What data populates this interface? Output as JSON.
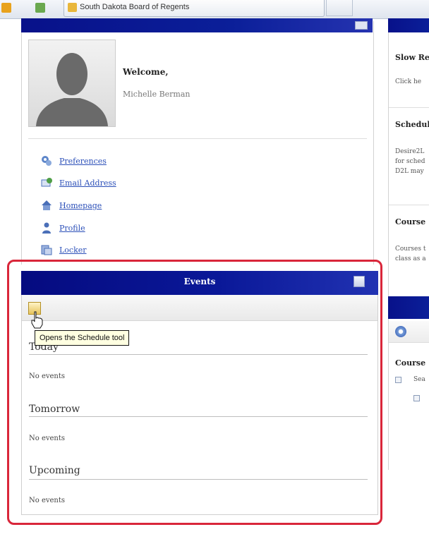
{
  "browser": {
    "tab_title": "South Dakota Board of Regents"
  },
  "profile": {
    "welcome": "Welcome,",
    "name": "Michelle Berman",
    "links": [
      {
        "label": "Preferences",
        "icon": "preferences-icon"
      },
      {
        "label": "Email Address",
        "icon": "email-icon"
      },
      {
        "label": "Homepage",
        "icon": "homepage-icon"
      },
      {
        "label": "Profile",
        "icon": "profile-icon"
      },
      {
        "label": "Locker",
        "icon": "locker-icon"
      }
    ]
  },
  "right_column": {
    "slow_title": "Slow Re",
    "slow_text": "Click he",
    "schedule_title": "Schedul",
    "schedule_lines": [
      "Desire2L",
      "for sched",
      "D2L may"
    ],
    "course_title": "Course",
    "course_lines": [
      "Courses t",
      "class as a"
    ],
    "courses_label": "Course",
    "tree_item": "Sea"
  },
  "events": {
    "title": "Events",
    "tooltip": "Opens the Schedule tool",
    "sections": [
      {
        "heading": "Today",
        "text": "No events"
      },
      {
        "heading": "Tomorrow",
        "text": "No events"
      },
      {
        "heading": "Upcoming",
        "text": "No events"
      }
    ]
  },
  "colors": {
    "header_blue": "#08118a",
    "highlight_red": "#d9263a",
    "link_blue": "#2b4fb8",
    "tooltip_bg": "#ffffe1"
  }
}
